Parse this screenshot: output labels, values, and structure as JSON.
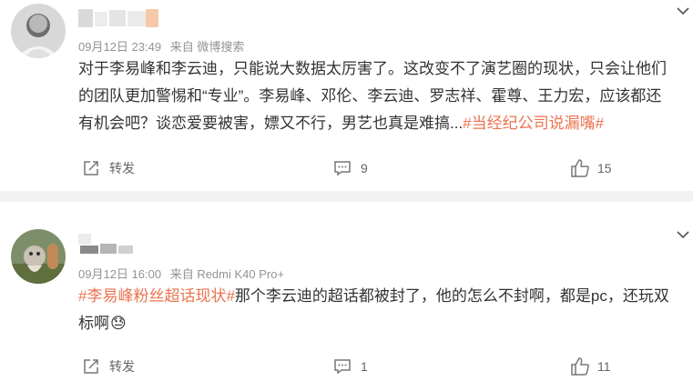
{
  "posts": [
    {
      "time": "09月12日 23:49",
      "source": "来自 微博搜索",
      "lines": [
        "对于李易峰和李云迪，只能说大数据太厉害了。这改变不了演艺圈的现状，只会让他们",
        "的团队更加警惕和“专业”。李易峰、邓伦、李云迪、罗志祥、霍尊、王力宏，应该都还"
      ],
      "line3_text": "有机会吧？谈恋爱要被害，嫖又不行，男艺也真是难搞...",
      "hashtag": "#当经纪公司说漏嘴#",
      "repost_label": "转发",
      "comment_count": "9",
      "like_count": "15"
    },
    {
      "time": "09月12日 16:00",
      "source": "来自 Redmi K40 Pro+",
      "line1_hashtag": "#李易峰粉丝超话现状#",
      "line1_text": "那个李云迪的超话都被封了，他的怎么不封啊，都是pc，还玩双",
      "line2_text": "标啊",
      "emoji": "😓",
      "repost_label": "转发",
      "comment_count": "1",
      "like_count": "11"
    }
  ],
  "icons": {
    "repost": "repost-icon",
    "comment": "comment-icon",
    "like": "like-icon",
    "more": "chevron-down-icon"
  },
  "colors": {
    "hashtag": "#eb7350",
    "meta": "#939393",
    "body_text": "#333333",
    "divider": "#f2f2f2"
  }
}
